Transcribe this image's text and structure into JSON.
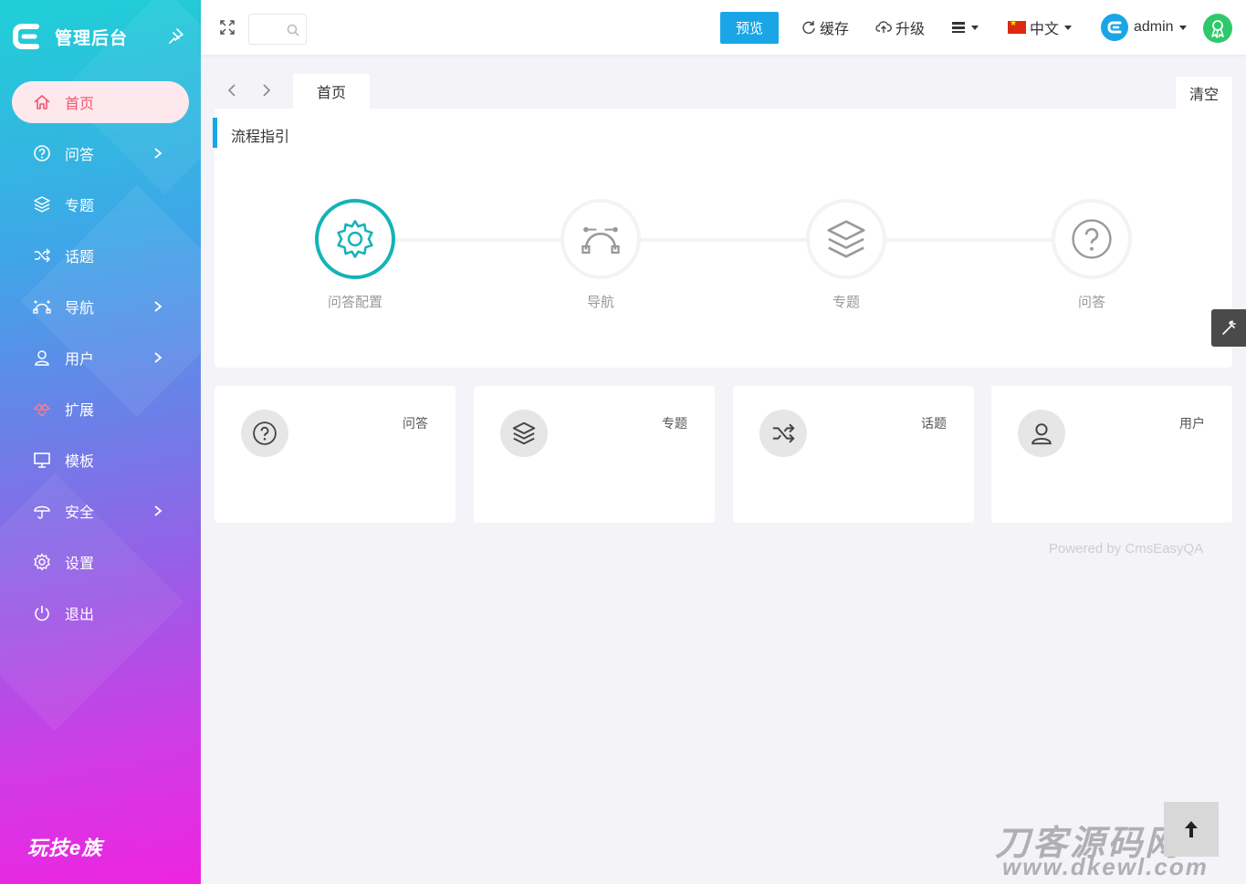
{
  "sidebar": {
    "title": "管理后台",
    "footer": "玩技e族",
    "items": [
      {
        "label": "首页",
        "icon": "home-icon",
        "active": true,
        "has_arrow": false
      },
      {
        "label": "问答",
        "icon": "question-circle-icon",
        "active": false,
        "has_arrow": true
      },
      {
        "label": "专题",
        "icon": "layers-icon",
        "active": false,
        "has_arrow": false
      },
      {
        "label": "话题",
        "icon": "shuffle-icon",
        "active": false,
        "has_arrow": false
      },
      {
        "label": "导航",
        "icon": "bezier-icon",
        "active": false,
        "has_arrow": true
      },
      {
        "label": "用户",
        "icon": "user-icon",
        "active": false,
        "has_arrow": true
      },
      {
        "label": "扩展",
        "icon": "hands-icon",
        "active": false,
        "has_arrow": false
      },
      {
        "label": "模板",
        "icon": "monitor-icon",
        "active": false,
        "has_arrow": false
      },
      {
        "label": "安全",
        "icon": "umbrella-icon",
        "active": false,
        "has_arrow": true
      },
      {
        "label": "设置",
        "icon": "gear-icon",
        "active": false,
        "has_arrow": false
      },
      {
        "label": "退出",
        "icon": "power-icon",
        "active": false,
        "has_arrow": false
      }
    ]
  },
  "topbar": {
    "search_value": "",
    "preview_label": "预览",
    "cache_label": "缓存",
    "upgrade_label": "升级",
    "language_label": "中文",
    "user_label": "admin"
  },
  "tabs": {
    "home_label": "首页",
    "clear_label": "清空"
  },
  "process": {
    "title": "流程指引",
    "steps": [
      {
        "label": "问答配置",
        "icon": "gear-icon",
        "active": true
      },
      {
        "label": "导航",
        "icon": "bezier-icon",
        "active": false
      },
      {
        "label": "专题",
        "icon": "layers-icon",
        "active": false
      },
      {
        "label": "问答",
        "icon": "question-circle-icon",
        "active": false
      }
    ]
  },
  "stats": [
    {
      "label": "问答",
      "icon": "question-circle-icon"
    },
    {
      "label": "专题",
      "icon": "layers-icon"
    },
    {
      "label": "话题",
      "icon": "shuffle-icon"
    },
    {
      "label": "用户",
      "icon": "user-icon"
    }
  ],
  "footer": {
    "powered": "Powered by CmsEasyQA",
    "watermark": "刀客源码网",
    "watermark_url": "www.dkewl.com"
  },
  "colors": {
    "accent": "#1aa6e6",
    "active_step": "#14b3b8",
    "active_menu": "#f2566c"
  }
}
